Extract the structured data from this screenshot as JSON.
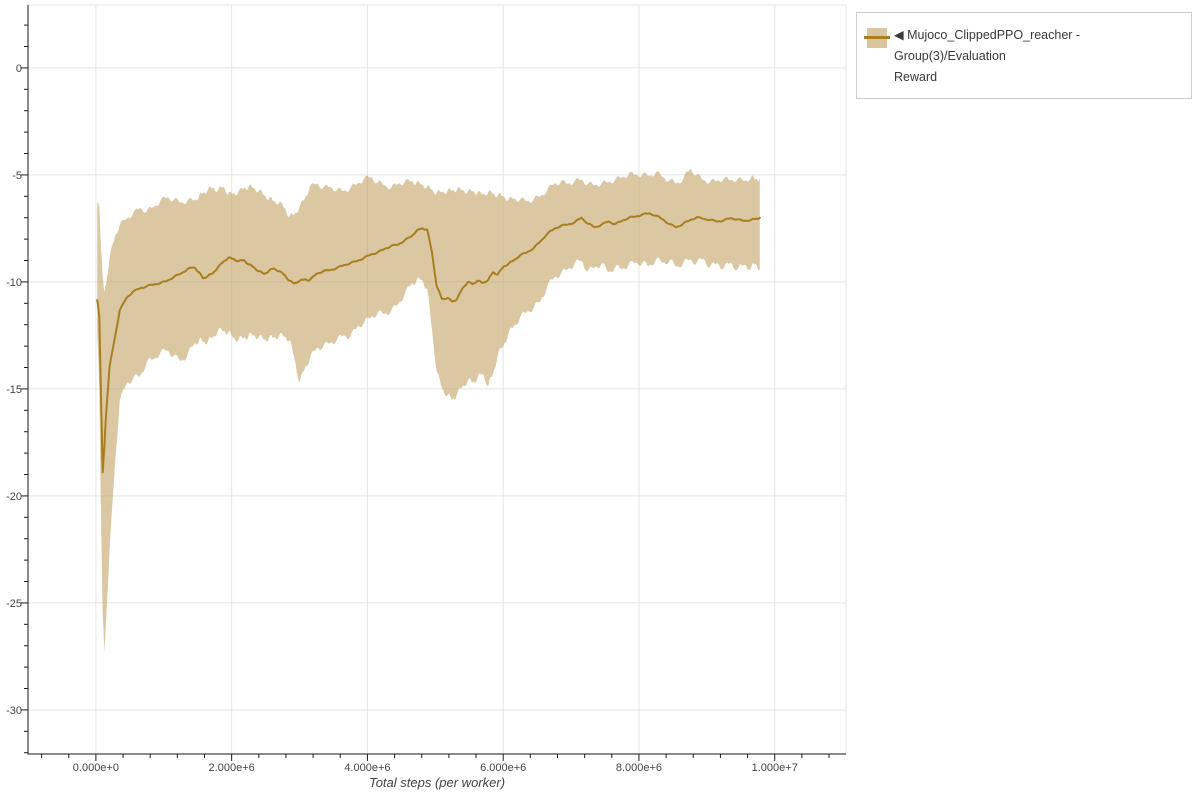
{
  "legend": {
    "marker": "left-triangle-icon",
    "label": "Mujoco_ClippedPPO_reacher - Group(3)/Evaluation Reward",
    "label_lines": [
      "◀ Mujoco_ClippedPPO_reacher - Group(3)/Evaluation",
      "Reward"
    ]
  },
  "colors": {
    "background": "#ffffff",
    "grid": "#e5e5e5",
    "outline": "#e5e5e5",
    "axis": "#1a1a1a",
    "tick_label": "#444444",
    "axis_label": "#444444",
    "legend_border": "#cccccc",
    "legend_text": "#3a3a3a",
    "line": "#a87e1f",
    "band": "#bd9b58",
    "band_solid": "#d9c59e"
  },
  "chart_data": {
    "type": "line",
    "title": "",
    "xlabel": "Total steps (per worker)",
    "ylabel": "",
    "x_unit": "steps, values stored in millions",
    "x_range": [
      -1.0,
      11.05
    ],
    "y_range": [
      -32.06,
      2.94
    ],
    "grid": true,
    "legend_position": "outside-top-right",
    "x_axis": {
      "major_ticks": [
        0,
        2,
        4,
        6,
        8,
        10
      ],
      "major_labels": [
        "0.000e+0",
        "2.000e+6",
        "4.000e+6",
        "6.000e+6",
        "8.000e+6",
        "1.000e+7"
      ],
      "minor_step": 0.4
    },
    "y_axis": {
      "major_ticks": [
        0,
        -5,
        -10,
        -15,
        -20,
        -25,
        -30
      ],
      "major_labels": [
        "0",
        "-5",
        "-10",
        "-15",
        "-20",
        "-25",
        "-30"
      ],
      "minor_step": 1
    },
    "series": [
      {
        "name": "Mujoco_ClippedPPO_reacher - Group(3)/Evaluation Reward",
        "color": "#a87e1f",
        "band_color": "#bd9b58",
        "band_opacity": 0.55,
        "line_width": 2,
        "x": [
          0.02,
          0.05,
          0.08,
          0.1,
          0.13,
          0.15,
          0.2,
          0.28,
          0.35,
          0.45,
          0.55,
          0.65,
          0.75,
          0.85,
          0.95,
          1.05,
          1.15,
          1.25,
          1.35,
          1.45,
          1.52,
          1.58,
          1.65,
          1.72,
          1.8,
          1.88,
          1.95,
          2.02,
          2.1,
          2.18,
          2.25,
          2.32,
          2.4,
          2.48,
          2.55,
          2.62,
          2.7,
          2.78,
          2.85,
          2.92,
          3.0,
          3.08,
          3.15,
          3.25,
          3.35,
          3.45,
          3.55,
          3.65,
          3.75,
          3.85,
          3.95,
          4.05,
          4.15,
          4.25,
          4.35,
          4.45,
          4.55,
          4.65,
          4.72,
          4.8,
          4.88,
          4.95,
          5.02,
          5.1,
          5.18,
          5.25,
          5.32,
          5.4,
          5.48,
          5.55,
          5.62,
          5.7,
          5.78,
          5.85,
          5.92,
          6.0,
          6.08,
          6.15,
          6.25,
          6.35,
          6.45,
          6.55,
          6.65,
          6.75,
          6.85,
          6.95,
          7.05,
          7.15,
          7.25,
          7.35,
          7.45,
          7.55,
          7.65,
          7.75,
          7.85,
          7.95,
          8.05,
          8.15,
          8.25,
          8.35,
          8.45,
          8.55,
          8.65,
          8.75,
          8.85,
          8.95,
          9.05,
          9.15,
          9.25,
          9.35,
          9.45,
          9.55,
          9.65,
          9.72,
          9.78
        ],
        "mean": [
          -10.85,
          -11.6,
          -16.0,
          -18.9,
          -17.4,
          -16.2,
          -14.0,
          -12.6,
          -11.35,
          -10.75,
          -10.45,
          -10.3,
          -10.2,
          -10.12,
          -10.05,
          -9.95,
          -9.76,
          -9.62,
          -9.4,
          -9.32,
          -9.55,
          -9.84,
          -9.72,
          -9.6,
          -9.31,
          -9.05,
          -8.87,
          -8.92,
          -9.03,
          -8.98,
          -9.18,
          -9.3,
          -9.5,
          -9.63,
          -9.48,
          -9.37,
          -9.5,
          -9.68,
          -9.95,
          -10.07,
          -9.95,
          -9.88,
          -9.92,
          -9.62,
          -9.5,
          -9.45,
          -9.35,
          -9.22,
          -9.12,
          -9.02,
          -8.88,
          -8.72,
          -8.62,
          -8.46,
          -8.32,
          -8.26,
          -8.05,
          -7.87,
          -7.62,
          -7.5,
          -7.55,
          -8.6,
          -10.2,
          -10.8,
          -10.75,
          -10.92,
          -10.8,
          -10.3,
          -10.0,
          -10.1,
          -9.95,
          -10.05,
          -9.9,
          -9.55,
          -9.65,
          -9.3,
          -9.15,
          -9.0,
          -8.75,
          -8.62,
          -8.42,
          -8.1,
          -7.75,
          -7.52,
          -7.38,
          -7.32,
          -7.22,
          -7.0,
          -7.28,
          -7.45,
          -7.32,
          -7.18,
          -7.3,
          -7.15,
          -7.0,
          -6.95,
          -6.85,
          -6.8,
          -6.9,
          -7.08,
          -7.3,
          -7.45,
          -7.28,
          -7.12,
          -6.98,
          -7.05,
          -7.1,
          -7.18,
          -7.12,
          -7.02,
          -7.08,
          -7.15,
          -7.1,
          -7.05,
          -7.0
        ],
        "upper": [
          -6.35,
          -6.5,
          -8.6,
          -9.8,
          -10.45,
          -10.1,
          -8.9,
          -7.9,
          -7.35,
          -7.05,
          -6.8,
          -6.55,
          -6.7,
          -6.5,
          -6.2,
          -6.05,
          -6.15,
          -6.3,
          -6.2,
          -6.18,
          -6.0,
          -5.85,
          -5.68,
          -5.6,
          -5.72,
          -5.55,
          -5.9,
          -5.88,
          -5.8,
          -5.62,
          -5.55,
          -5.6,
          -5.75,
          -5.95,
          -6.1,
          -6.22,
          -6.3,
          -6.55,
          -6.95,
          -6.85,
          -6.5,
          -6.1,
          -5.58,
          -5.4,
          -5.6,
          -5.55,
          -5.7,
          -5.75,
          -5.62,
          -5.42,
          -5.18,
          -5.1,
          -5.35,
          -5.48,
          -5.6,
          -5.42,
          -5.32,
          -5.3,
          -5.38,
          -5.45,
          -5.55,
          -5.7,
          -5.85,
          -5.8,
          -5.75,
          -5.72,
          -5.68,
          -5.72,
          -5.78,
          -5.75,
          -5.85,
          -5.9,
          -5.8,
          -5.88,
          -5.95,
          -6.0,
          -6.15,
          -6.1,
          -6.15,
          -6.22,
          -6.15,
          -6.0,
          -5.7,
          -5.42,
          -5.32,
          -5.42,
          -5.3,
          -5.22,
          -5.42,
          -5.48,
          -5.4,
          -5.35,
          -5.22,
          -5.12,
          -4.95,
          -5.0,
          -4.98,
          -5.05,
          -4.88,
          -5.1,
          -5.25,
          -5.4,
          -5.2,
          -4.72,
          -5.0,
          -5.25,
          -5.32,
          -5.28,
          -5.18,
          -5.25,
          -5.2,
          -5.28,
          -5.12,
          -5.2,
          -5.15
        ],
        "lower": [
          -12.5,
          -15.0,
          -22.0,
          -25.5,
          -27.3,
          -25.8,
          -22.6,
          -18.6,
          -15.6,
          -14.75,
          -14.5,
          -14.4,
          -13.75,
          -13.6,
          -13.3,
          -13.2,
          -13.45,
          -13.7,
          -13.4,
          -12.9,
          -12.72,
          -12.8,
          -12.78,
          -12.6,
          -12.26,
          -12.3,
          -12.34,
          -12.6,
          -12.7,
          -12.62,
          -12.52,
          -12.5,
          -12.56,
          -12.7,
          -12.62,
          -12.6,
          -12.5,
          -12.56,
          -12.7,
          -13.5,
          -14.7,
          -14.0,
          -13.6,
          -13.1,
          -13.0,
          -12.85,
          -12.7,
          -12.5,
          -12.55,
          -12.1,
          -11.9,
          -11.65,
          -11.45,
          -11.5,
          -11.35,
          -11.05,
          -10.55,
          -10.1,
          -9.95,
          -9.9,
          -10.3,
          -12.2,
          -14.2,
          -15.0,
          -15.3,
          -15.5,
          -15.25,
          -14.9,
          -14.6,
          -14.7,
          -14.5,
          -14.3,
          -14.85,
          -14.3,
          -13.4,
          -13.0,
          -12.4,
          -12.1,
          -11.65,
          -11.4,
          -11.2,
          -10.9,
          -10.2,
          -9.8,
          -9.62,
          -9.4,
          -9.15,
          -9.0,
          -9.5,
          -9.32,
          -9.15,
          -9.55,
          -9.3,
          -9.4,
          -9.18,
          -9.1,
          -9.12,
          -9.25,
          -8.95,
          -9.1,
          -9.0,
          -9.3,
          -9.12,
          -8.95,
          -9.1,
          -8.92,
          -9.3,
          -9.12,
          -9.35,
          -9.1,
          -9.42,
          -9.2,
          -9.35,
          -9.15,
          -9.4
        ]
      }
    ]
  }
}
